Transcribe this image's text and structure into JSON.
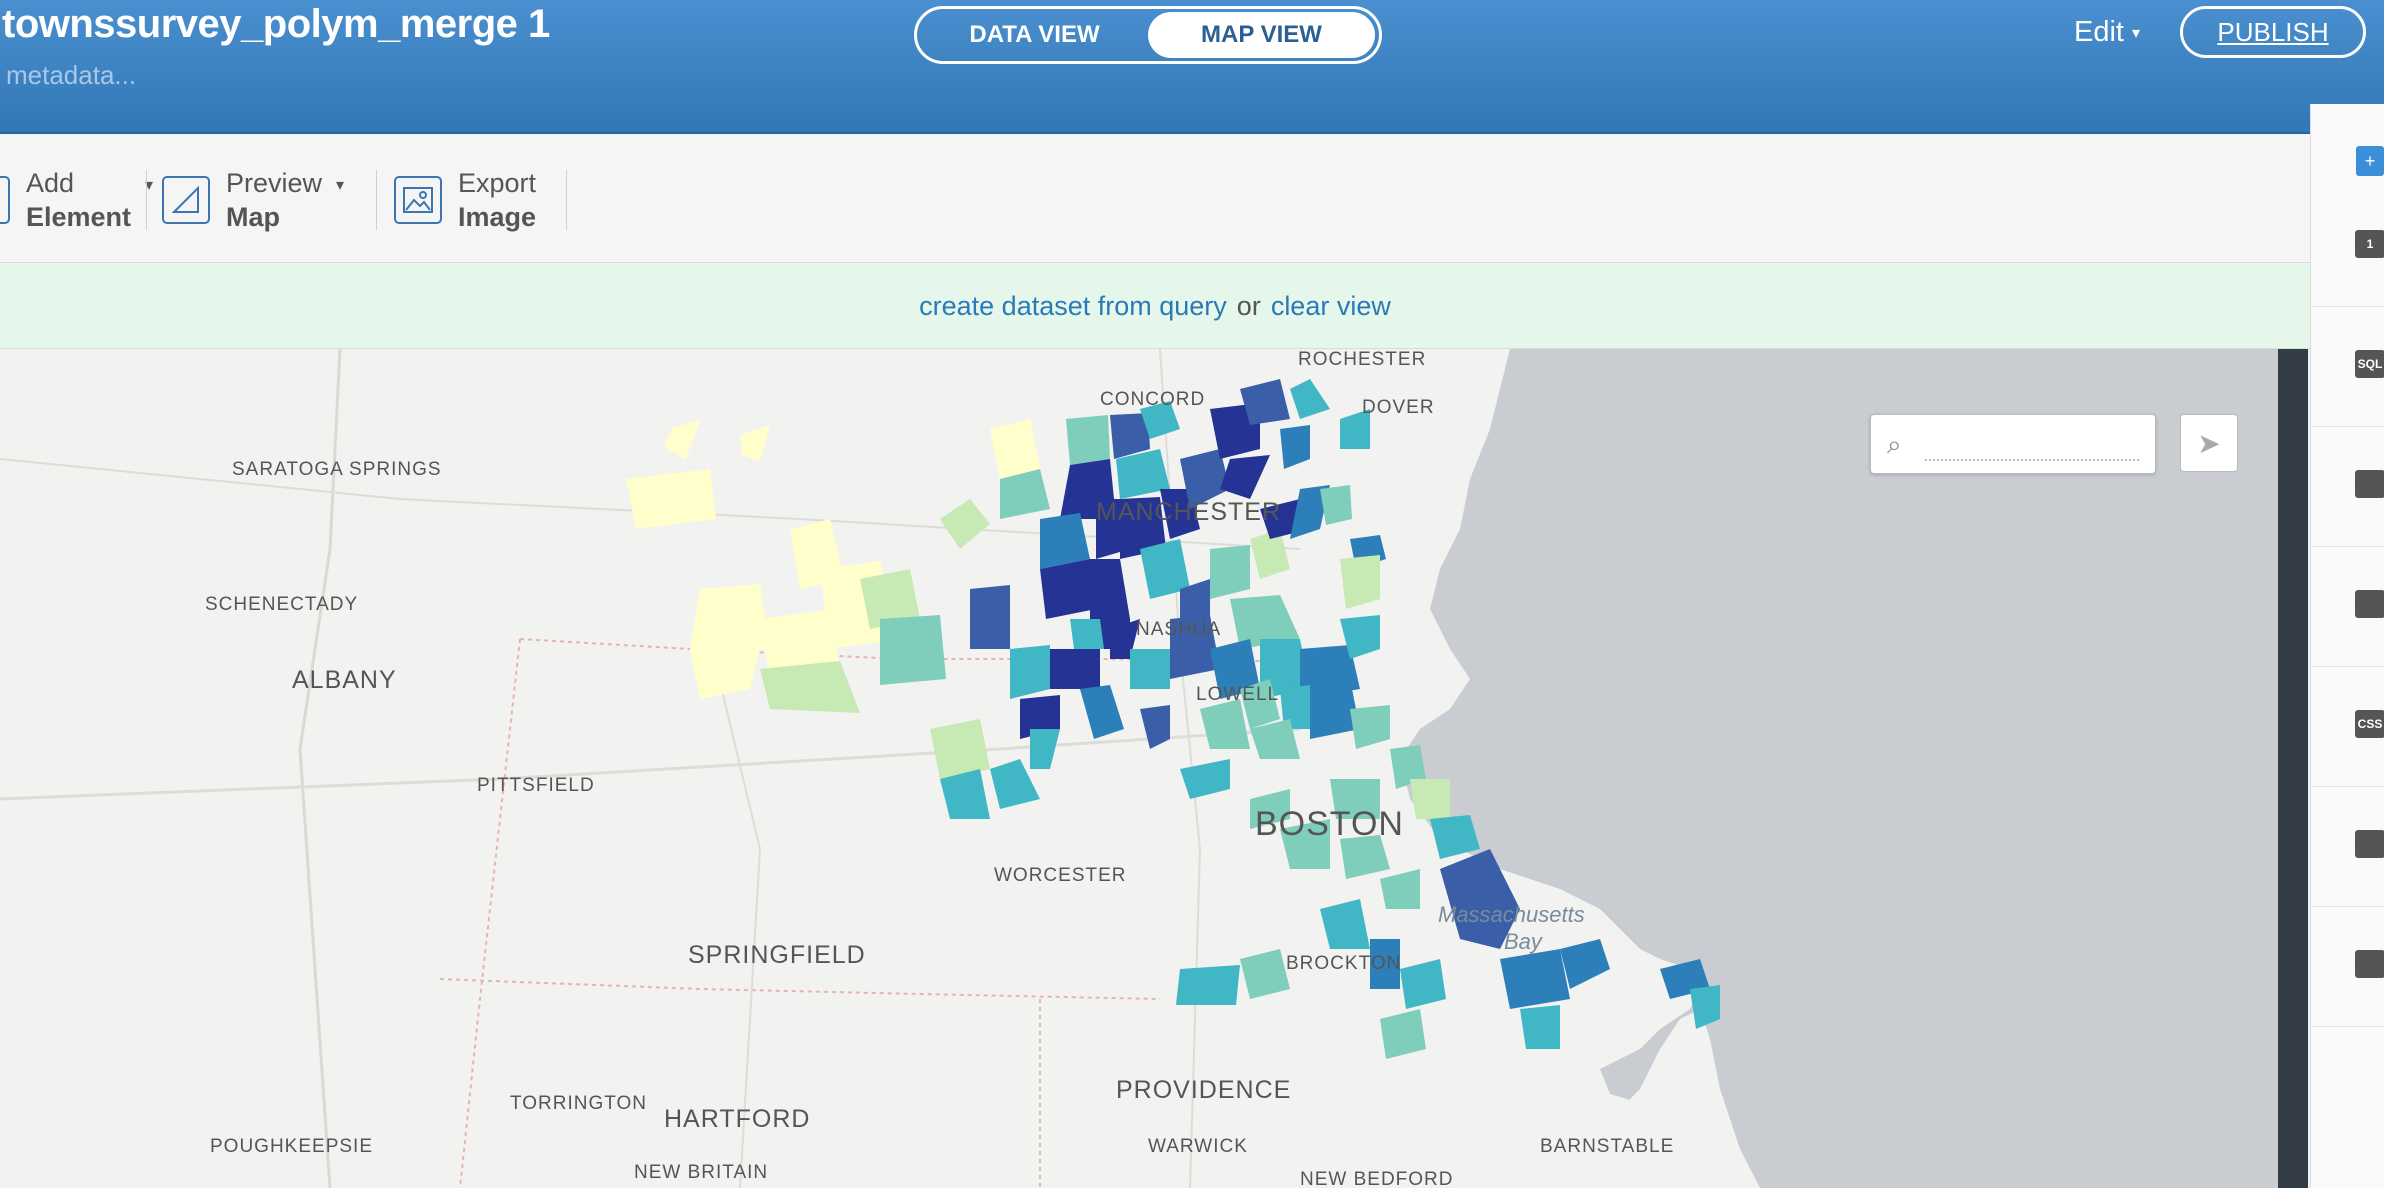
{
  "header": {
    "title": "townssurvey_polym_merge 1",
    "subtitle": "metadata...",
    "data_view_label": "DATA VIEW",
    "map_view_label": "MAP VIEW",
    "edit_label": "Edit",
    "publish_label": "PUBLISH"
  },
  "toolbar": {
    "add_element": {
      "line1": "Add",
      "line2": "Element"
    },
    "preview_map": {
      "line1": "Preview",
      "line2": "Map"
    },
    "export_image": {
      "line1": "Export",
      "line2": "Image"
    }
  },
  "notice": {
    "create_link": "create dataset from query",
    "or_text": "or",
    "clear_link": "clear view"
  },
  "map": {
    "labels": {
      "rochester": "ROCHESTER",
      "concord": "CONCORD",
      "dover": "DOVER",
      "saratoga": "SARATOGA SPRINGS",
      "manchester": "MANCHESTER",
      "schenectady": "SCHENECTADY",
      "nashua": "NASHUA",
      "albany": "ALBANY",
      "lowell": "LOWELL",
      "pittsfield": "PITTSFIELD",
      "boston": "BOSTON",
      "worcester": "WORCESTER",
      "massachusetts_bay_1": "Massachusetts",
      "massachusetts_bay_2": "Bay",
      "springfield": "SPRINGFIELD",
      "brockton": "BROCKTON",
      "providence": "PROVIDENCE",
      "torrington": "TORRINGTON",
      "hartford": "HARTFORD",
      "poughkeepsie": "POUGHKEEPSIE",
      "warwick": "WARWICK",
      "barnstable": "BARNSTABLE",
      "new_britain": "NEW BRITAIN",
      "new_bedford": "NEW BEDFORD"
    },
    "colors": {
      "water": "#c9cdd1",
      "land": "#f2f2f0",
      "ramp": [
        "#ffffcc",
        "#c7e9b4",
        "#7fcdbb",
        "#41b6c4",
        "#2c7fb8",
        "#3a5fa8",
        "#253494"
      ]
    }
  },
  "sidebar": {
    "items": [
      {
        "icon": "layers-icon",
        "text": "1"
      },
      {
        "icon": "sql-icon",
        "text": "SQL"
      },
      {
        "icon": "wizard-icon",
        "text": ""
      },
      {
        "icon": "infowindow-icon",
        "text": ""
      },
      {
        "icon": "css-icon",
        "text": "CSS"
      },
      {
        "icon": "legend-icon",
        "text": ""
      },
      {
        "icon": "chart-icon",
        "text": ""
      }
    ]
  }
}
